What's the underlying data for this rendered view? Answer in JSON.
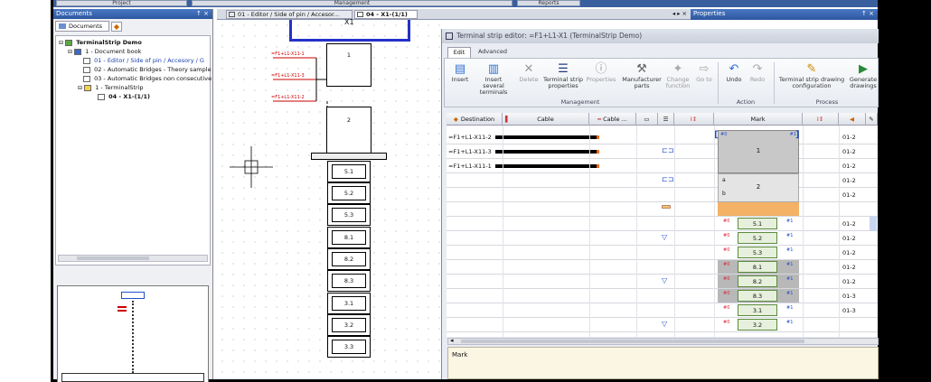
{
  "top_tabs": [
    "Project",
    "Management",
    "Reports"
  ],
  "documents_panel": {
    "title": "Documents",
    "pin": "↑ ×",
    "tab": "Documents",
    "tree": [
      {
        "label": "TerminalStrip Demo",
        "bold": true
      },
      {
        "label": "1 - Document book"
      },
      {
        "label": "01 - Editor /  Side of pin / Accesory / G"
      },
      {
        "label": "02 - Automatic Bridges - Theory sample"
      },
      {
        "label": "03 - Automatic Bridges non consecutive"
      },
      {
        "label": "1 - TerminalStrip"
      },
      {
        "label": "04 - X1-(1/1)",
        "bold": true
      }
    ]
  },
  "doc_tabs": [
    {
      "label": "01 - Editor / Side of pin / Accesor...",
      "active": false
    },
    {
      "label": "04 - X1-(1/1)",
      "active": true
    }
  ],
  "doc_tabs_nav": "◂ ▸ ×",
  "properties_panel": {
    "title": "Properties",
    "pin": "↑ ×"
  },
  "canvas": {
    "title_fragment": "X1",
    "wire_labels": [
      "=F1+L1-X11-1",
      "=F1+L1-X11-3",
      "=F1+L1-X11-2"
    ],
    "terminals": [
      "1",
      "2",
      "5.1",
      "5.2",
      "5.3",
      "8.1",
      "8.2",
      "8.3",
      "3.1",
      "3.2",
      "3.3"
    ]
  },
  "editor": {
    "title": "Terminal strip editor: =F1+L1-X1 (TerminalStrip Demo)",
    "tabs": [
      "Edit",
      "Advanced"
    ],
    "groups": {
      "management": "Management",
      "action": "Action",
      "process": "Process"
    },
    "buttons": [
      {
        "label": "Insert",
        "icon": "insert-icon"
      },
      {
        "label": "Insert several terminals",
        "icon": "insert-several-icon"
      },
      {
        "label": "Delete",
        "icon": "delete-icon"
      },
      {
        "label": "Terminal strip properties",
        "icon": "strip-properties-icon"
      },
      {
        "label": "Properties",
        "icon": "properties-icon"
      },
      {
        "label": "Manufacturer parts",
        "icon": "manufacturer-parts-icon"
      },
      {
        "label": "Change function",
        "icon": "change-function-icon"
      },
      {
        "label": "Go to",
        "icon": "goto-icon"
      },
      {
        "label": "Undo",
        "icon": "undo-icon"
      },
      {
        "label": "Redo",
        "icon": "redo-icon"
      },
      {
        "label": "Terminal strip drawing configuration",
        "icon": "drawing-config-icon"
      },
      {
        "label": "Generate drawings",
        "icon": "generate-drawings-icon"
      }
    ],
    "columns": [
      "Destination",
      "Cable",
      "Cable ...",
      "Mark"
    ],
    "rows": [
      {
        "destination": "=F1+L1-X11-2",
        "mark": "",
        "level": "01-2"
      },
      {
        "destination": "=F1+L1-X11-3",
        "mark": "1",
        "level": "01-2"
      },
      {
        "destination": "=F1+L1-X11-1",
        "mark": "",
        "level": "01-2"
      },
      {
        "destination": "",
        "mark": "2",
        "level": "01-2"
      },
      {
        "destination": "",
        "mark": "",
        "level": "01-2"
      },
      {
        "destination": "",
        "mark": "",
        "level": ""
      },
      {
        "destination": "",
        "mark": "5.1",
        "level": "01-2"
      },
      {
        "destination": "",
        "mark": "5.2",
        "level": "01-2"
      },
      {
        "destination": "",
        "mark": "5.3",
        "level": "01-2"
      },
      {
        "destination": "",
        "mark": "8.1",
        "level": "01-2"
      },
      {
        "destination": "",
        "mark": "8.2",
        "level": "01-2"
      },
      {
        "destination": "",
        "mark": "8.3",
        "level": "01-3"
      },
      {
        "destination": "",
        "mark": "3.1",
        "level": "01-3"
      },
      {
        "destination": "",
        "mark": "3.2",
        "level": ""
      }
    ],
    "side_tags": {
      "a": "a",
      "b": "b",
      "p0": "#0",
      "p1": "#1"
    },
    "status_label": "Mark"
  }
}
